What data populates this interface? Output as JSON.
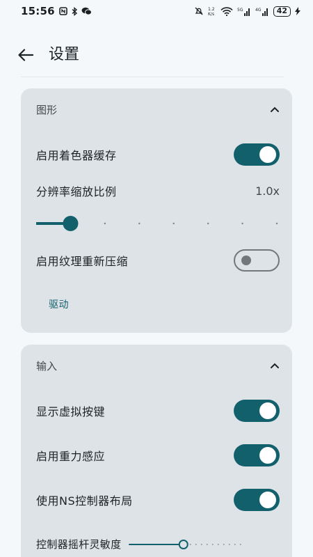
{
  "status_bar": {
    "time": "15:56",
    "speed": "1.2\nK/s",
    "battery": "42",
    "net_5g": "5G",
    "net_4g": "4G"
  },
  "app_bar": {
    "title": "设置",
    "back_icon": "arrow-left-icon"
  },
  "graphics": {
    "header": "图形",
    "expanded": true,
    "shader_cache_label": "启用着色器缓存",
    "shader_cache_on": true,
    "resolution_label": "分辨率缩放比例",
    "resolution_value": "1.0x",
    "resolution_slider_step": 1,
    "resolution_slider_steps": 8,
    "texture_recompress_label": "启用纹理重新压缩",
    "texture_recompress_on": false,
    "driver_link": "驱动"
  },
  "input": {
    "header": "输入",
    "expanded": true,
    "virtual_keys_label": "显示虚拟按键",
    "virtual_keys_on": true,
    "gyro_label": "启用重力感应",
    "gyro_on": true,
    "ns_layout_label": "使用NS控制器布局",
    "ns_layout_on": true,
    "stick_sensitivity_label": "控制器摇杆灵敏度",
    "stick_sensitivity_fraction": 0.48
  },
  "colors": {
    "accent": "#13606d",
    "card_bg": "#dde3e6",
    "page_bg": "#f5f8fa"
  }
}
